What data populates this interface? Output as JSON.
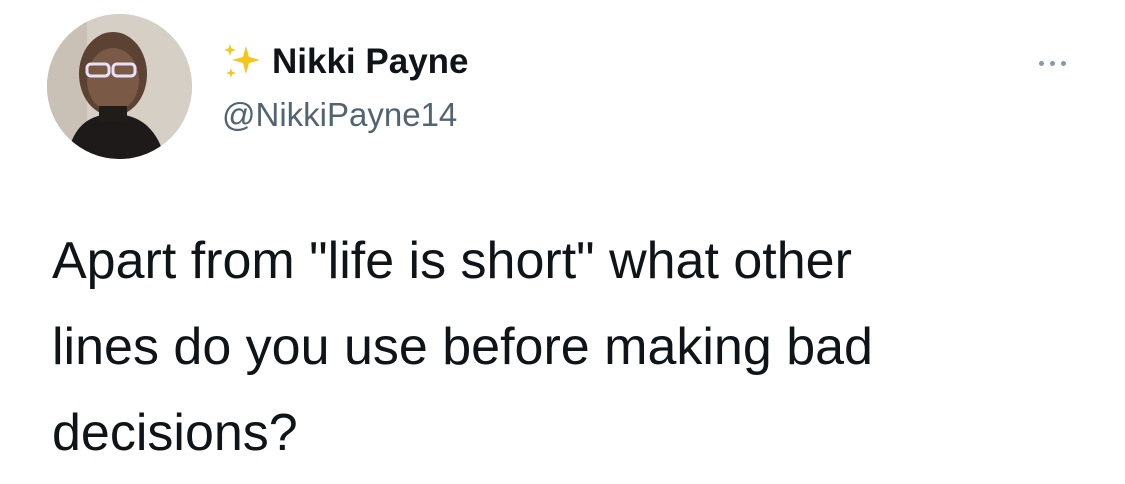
{
  "author": {
    "display_name": "Nikki Payne",
    "handle": "@NikkiPayne14",
    "name_prefix_icon": "sparkles-icon",
    "avatar": "profile-photo"
  },
  "tweet": {
    "text": "Apart from \"life is short\" what other\nlines do you use before making bad\ndecisions?"
  },
  "actions": {
    "more_icon": "more-options-icon"
  },
  "colors": {
    "text_primary": "#0f1419",
    "text_secondary": "#536471",
    "sparkle": "#f5c518",
    "background": "#ffffff"
  }
}
